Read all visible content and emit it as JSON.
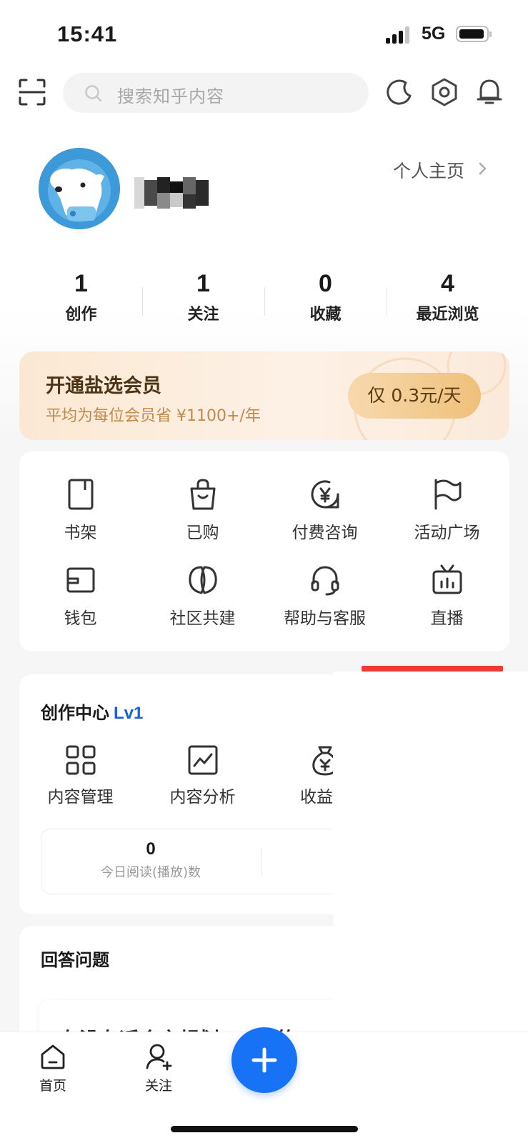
{
  "status_bar": {
    "time": "15:41",
    "network": "5G"
  },
  "header": {
    "search_placeholder": "搜索知乎内容"
  },
  "profile": {
    "link_label": "个人主页"
  },
  "stats": [
    {
      "value": "1",
      "label": "创作"
    },
    {
      "value": "1",
      "label": "关注"
    },
    {
      "value": "0",
      "label": "收藏"
    },
    {
      "value": "4",
      "label": "最近浏览"
    }
  ],
  "vip": {
    "title": "开通盐选会员",
    "subtitle": "平均为每位会员省 ¥1100+/年",
    "button": "仅 0.3元/天"
  },
  "tools": [
    {
      "label": "书架",
      "icon": "bookshelf-icon"
    },
    {
      "label": "已购",
      "icon": "shopping-bag-icon"
    },
    {
      "label": "付费咨询",
      "icon": "paid-consult-icon"
    },
    {
      "label": "活动广场",
      "icon": "flag-icon"
    },
    {
      "label": "钱包",
      "icon": "wallet-icon"
    },
    {
      "label": "社区共建",
      "icon": "leaves-icon"
    },
    {
      "label": "帮助与客服",
      "icon": "headset-icon"
    },
    {
      "label": "直播",
      "icon": "tv-icon"
    }
  ],
  "creation_center": {
    "title": "创作中心",
    "level": "Lv1",
    "items": [
      {
        "label": "内容管理",
        "icon": "grid-icon"
      },
      {
        "label": "内容分析",
        "icon": "chart-icon"
      },
      {
        "label": "收益分",
        "icon": "money-bag-icon"
      }
    ],
    "metrics": [
      {
        "value": "0",
        "label": "今日阅读(播放)数"
      }
    ]
  },
  "answer_section": {
    "title": "回答问题",
    "question_preview": "在没有适合之规划 ... 消的"
  },
  "tab_bar": {
    "tabs": [
      {
        "label": "首页",
        "icon": "home-icon"
      },
      {
        "label": "关注",
        "icon": "follow-icon"
      }
    ],
    "fab_icon": "plus-icon"
  },
  "colors": {
    "accent_blue": "#1772f6",
    "level_blue": "#1a63d6",
    "vip_text": "#4d3418",
    "vip_sub": "#c08a4c",
    "red_indicator": "#ee3a34"
  }
}
